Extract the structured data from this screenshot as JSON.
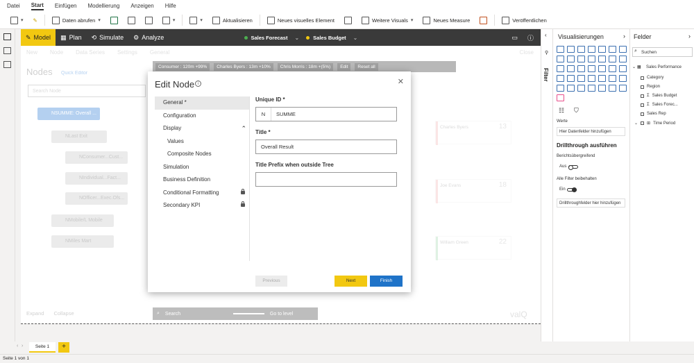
{
  "ribbon": {
    "menu": [
      "Datei",
      "Start",
      "Einfügen",
      "Modellierung",
      "Anzeigen",
      "Hilfe"
    ],
    "active_menu": "Start",
    "toolbar": {
      "get_data": "Daten abrufen",
      "refresh": "Aktualisieren",
      "new_visual": "Neues visuelles Element",
      "more_visuals": "Weitere Visuals",
      "new_measure": "Neues Measure",
      "publish": "Veröffentlichen"
    }
  },
  "valq": {
    "modes": [
      "Model",
      "Plan",
      "Simulate",
      "Analyze"
    ],
    "active_mode": "Model",
    "scenarios": [
      {
        "name": "Sales Forecast",
        "color": "#4caf50"
      },
      {
        "name": "Sales Budget",
        "color": "#f2c811"
      }
    ],
    "tabs": [
      "New",
      "Node",
      "Data Series",
      "Settings",
      "General"
    ],
    "close": "Close",
    "nodes_title": "Nodes",
    "quick_editor": "Quick Editor",
    "search_placeholder": "Search Node",
    "tree": [
      "NSUMME: Overall ...",
      "NLast Exit",
      "NConsumer...Cust...",
      "NIndividual...Fact...",
      "NOfficer...Exec.Ofs...",
      "NMobile/L Mobile",
      "NMiles Mart"
    ],
    "expand": "Expand",
    "collapse": "Collapse",
    "greybar": [
      "Consumer : 120m  +99%",
      "Charles Byers : 13m  +10%",
      "Chris Morris : 18m  +(5%)",
      "Edit",
      "Reset all"
    ],
    "kpis": [
      {
        "name": "Charles Byers",
        "value": "13",
        "color": "#f4b6b6"
      },
      {
        "name": "Joe Evans",
        "value": "18",
        "color": "#f4b6b6"
      },
      {
        "name": "William Green",
        "value": "22",
        "color": "#a6dcb0"
      }
    ],
    "bottom_search": "Search",
    "goto_level": "Go to level",
    "brand": "valQ"
  },
  "modal": {
    "title": "Edit Node",
    "nav": [
      {
        "label": "General *",
        "selected": true
      },
      {
        "label": "Configuration"
      },
      {
        "label": "Display",
        "expanded": true
      },
      {
        "label": "Values",
        "sub": true
      },
      {
        "label": "Composite Nodes",
        "sub": true
      },
      {
        "label": "Simulation"
      },
      {
        "label": "Business Definition"
      },
      {
        "label": "Conditional Formatting",
        "locked": true
      },
      {
        "label": "Secondary KPI",
        "locked": true
      }
    ],
    "unique_id_label": "Unique ID *",
    "unique_id_prefix": "N",
    "unique_id_value": "SUMME",
    "title_label": "Title *",
    "title_value": "Overall Result",
    "prefix_label": "Title Prefix when outside Tree",
    "prefix_value": "",
    "previous": "Previous",
    "next": "Next",
    "finish": "Finish"
  },
  "filter_label": "Filter",
  "viz_pane": {
    "title": "Visualisierungen",
    "werte": "Werte",
    "werte_placeholder": "Hier Datenfelder hinzufügen",
    "drill_title": "Drillthrough ausführen",
    "cross_report": "Berichtsübergreifend",
    "off": "Aus",
    "keep_filters": "Alle Filter beibehalten",
    "on": "Ein",
    "drill_placeholder": "Drillthroughfelder hier hinzufügen"
  },
  "fields_pane": {
    "title": "Felder",
    "search": "Suchen",
    "table": "Sales Performance",
    "fields": [
      "Category",
      "Region",
      "Sales Budget",
      "Sales Forec...",
      "Sales Rep",
      "Time Period"
    ]
  },
  "pages": {
    "tab": "Seite 1",
    "add": "+"
  },
  "status": "Seite 1 von 1"
}
